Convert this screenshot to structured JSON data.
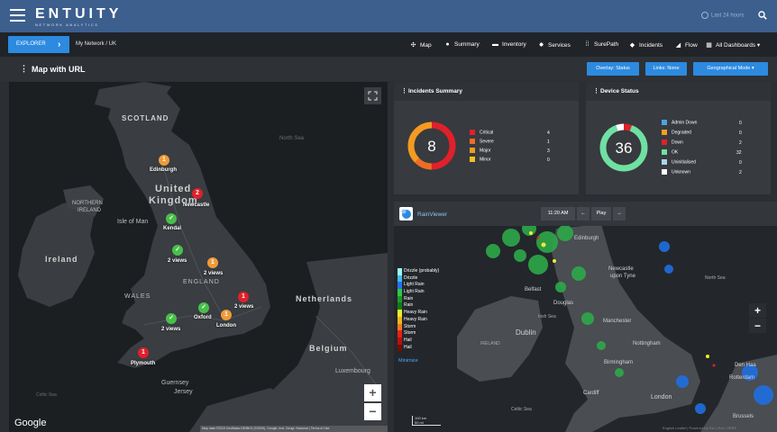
{
  "app": {
    "logo": "ENTUITY",
    "logo_sub": "NETWORK ANALYTICS",
    "time_filter": "Last 24 hours"
  },
  "nav": {
    "explorer_label": "EXPLORER",
    "breadcrumb": "My Network  /  UK",
    "items": [
      {
        "label": "Map",
        "icon": "map-icon"
      },
      {
        "label": "Summary",
        "icon": "info-icon"
      },
      {
        "label": "Inventory",
        "icon": "folder-icon"
      },
      {
        "label": "Services",
        "icon": "services-icon"
      },
      {
        "label": "SurePath",
        "icon": "surepath-icon"
      },
      {
        "label": "Incidents",
        "icon": "shield-icon"
      },
      {
        "label": "Flow",
        "icon": "flow-icon"
      },
      {
        "label": "All Dashboards",
        "icon": "dashboard-icon"
      }
    ]
  },
  "page": {
    "title": "Map with URL",
    "overlay_button": "Overlay: Status",
    "links_button": "Links: None",
    "geo_button": "Geographical Mode"
  },
  "map": {
    "labels": {
      "scotland": "SCOTLAND",
      "north_sea": "North Sea",
      "united_kingdom_1": "United",
      "united_kingdom_2": "Kingdom",
      "northern_ireland_1": "NORTHERN",
      "northern_ireland_2": "IRELAND",
      "isle_of_man": "Isle of Man",
      "ireland": "Ireland",
      "england": "ENGLAND",
      "wales": "WALES",
      "netherlands": "Netherlands",
      "belgium": "Belgium",
      "luxembourg": "Luxembourg",
      "guernsey": "Guernsey",
      "jersey": "Jersey",
      "celtic_sea": "Celtic Sea"
    },
    "markers": [
      {
        "label": "Edinburgh",
        "badge": "1",
        "status": "orange"
      },
      {
        "label": "Newcastle",
        "badge": "2",
        "status": "red"
      },
      {
        "label": "Kendal",
        "badge": "✓",
        "status": "green"
      },
      {
        "label": "2 views",
        "badge": "✓",
        "status": "green"
      },
      {
        "label": "2 views",
        "badge": "1",
        "status": "orange"
      },
      {
        "label": "2 views",
        "badge": "1",
        "status": "red"
      },
      {
        "label": "Oxford",
        "badge": "✓",
        "status": "green"
      },
      {
        "label": "London",
        "badge": "1",
        "status": "orange"
      },
      {
        "label": "2 views",
        "badge": "✓",
        "status": "green"
      },
      {
        "label": "Plymouth",
        "badge": "1",
        "status": "red"
      }
    ],
    "google": "Google",
    "attribution": "Map data ©2019 GeoBasis-DE/BKG (©2009), Google, Inst. Geogr. Nacional | Terms of Use",
    "zoom_in": "+",
    "zoom_out": "−"
  },
  "incidents": {
    "title": "Incidents Summary",
    "total": "8",
    "colors": {
      "critical": "#e0202a",
      "severe": "#ef6c25",
      "major": "#f49a21",
      "minor": "#f3c21f"
    },
    "rows": [
      {
        "label": "Critical",
        "value": "4"
      },
      {
        "label": "Severe",
        "value": "1"
      },
      {
        "label": "Major",
        "value": "3"
      },
      {
        "label": "Minor",
        "value": "0"
      }
    ]
  },
  "devices": {
    "title": "Device Status",
    "total": "36",
    "colors": {
      "admin_down": "#4aa3e0",
      "degraded": "#f29f1f",
      "down": "#e0202a",
      "ok": "#6fe0a2",
      "uninitialised": "#a9d3ee",
      "unknown": "#ffffff"
    },
    "rows": [
      {
        "label": "Admin Down",
        "value": "0"
      },
      {
        "label": "Degraded",
        "value": "0"
      },
      {
        "label": "Down",
        "value": "2"
      },
      {
        "label": "OK",
        "value": "32"
      },
      {
        "label": "Uninitialised",
        "value": "0"
      },
      {
        "label": "Unknown",
        "value": "2"
      }
    ]
  },
  "rainviewer": {
    "title": "RainViewer",
    "time": "11:20 AM",
    "prev": "←",
    "play": "Play",
    "next": "→",
    "legend": [
      {
        "label": "Drizzle (probably)",
        "color": "#9ef4f4"
      },
      {
        "label": "Drizzle",
        "color": "#3fbcf4"
      },
      {
        "label": "Light Rain",
        "color": "#2c6ef0"
      },
      {
        "label": "Light Rain",
        "color": "#29cc3f"
      },
      {
        "label": "Rain",
        "color": "#1f9a2a"
      },
      {
        "label": "Rain",
        "color": "#137a19"
      },
      {
        "label": "Heavy Rain",
        "color": "#f0ec2a"
      },
      {
        "label": "Heavy Rain",
        "color": "#f2b41e"
      },
      {
        "label": "Storm",
        "color": "#f07a1a"
      },
      {
        "label": "Storm",
        "color": "#e8201a"
      },
      {
        "label": "Hail",
        "color": "#b8120e"
      },
      {
        "label": "Hail",
        "color": "#7a0a08"
      }
    ],
    "minimize": "Minimize",
    "labels": {
      "edinburgh": "Edinburgh",
      "newcastle_1": "Newcastle",
      "newcastle_2": "upon Tyne",
      "belfast": "Belfast",
      "douglas": "Douglas",
      "irish_sea": "Irish Sea",
      "dublin": "Dublin",
      "ireland": "IRELAND",
      "manchester": "Manchester",
      "nottingham": "Nottingham",
      "birmingham": "Birmingham",
      "cardiff": "Cardiff",
      "london": "London",
      "celtic_sea": "Celtic Sea",
      "den_haag": "Den Haa",
      "rotterdam": "Rotterdam",
      "brussels": "Brussels",
      "north_sea": "North Sea"
    },
    "scale_km": "100 km",
    "scale_mi": "50 mi",
    "zoom_in": "+",
    "zoom_out": "−",
    "attribution": "English Leaflet | Powered by Esri | Esri, HERE"
  }
}
